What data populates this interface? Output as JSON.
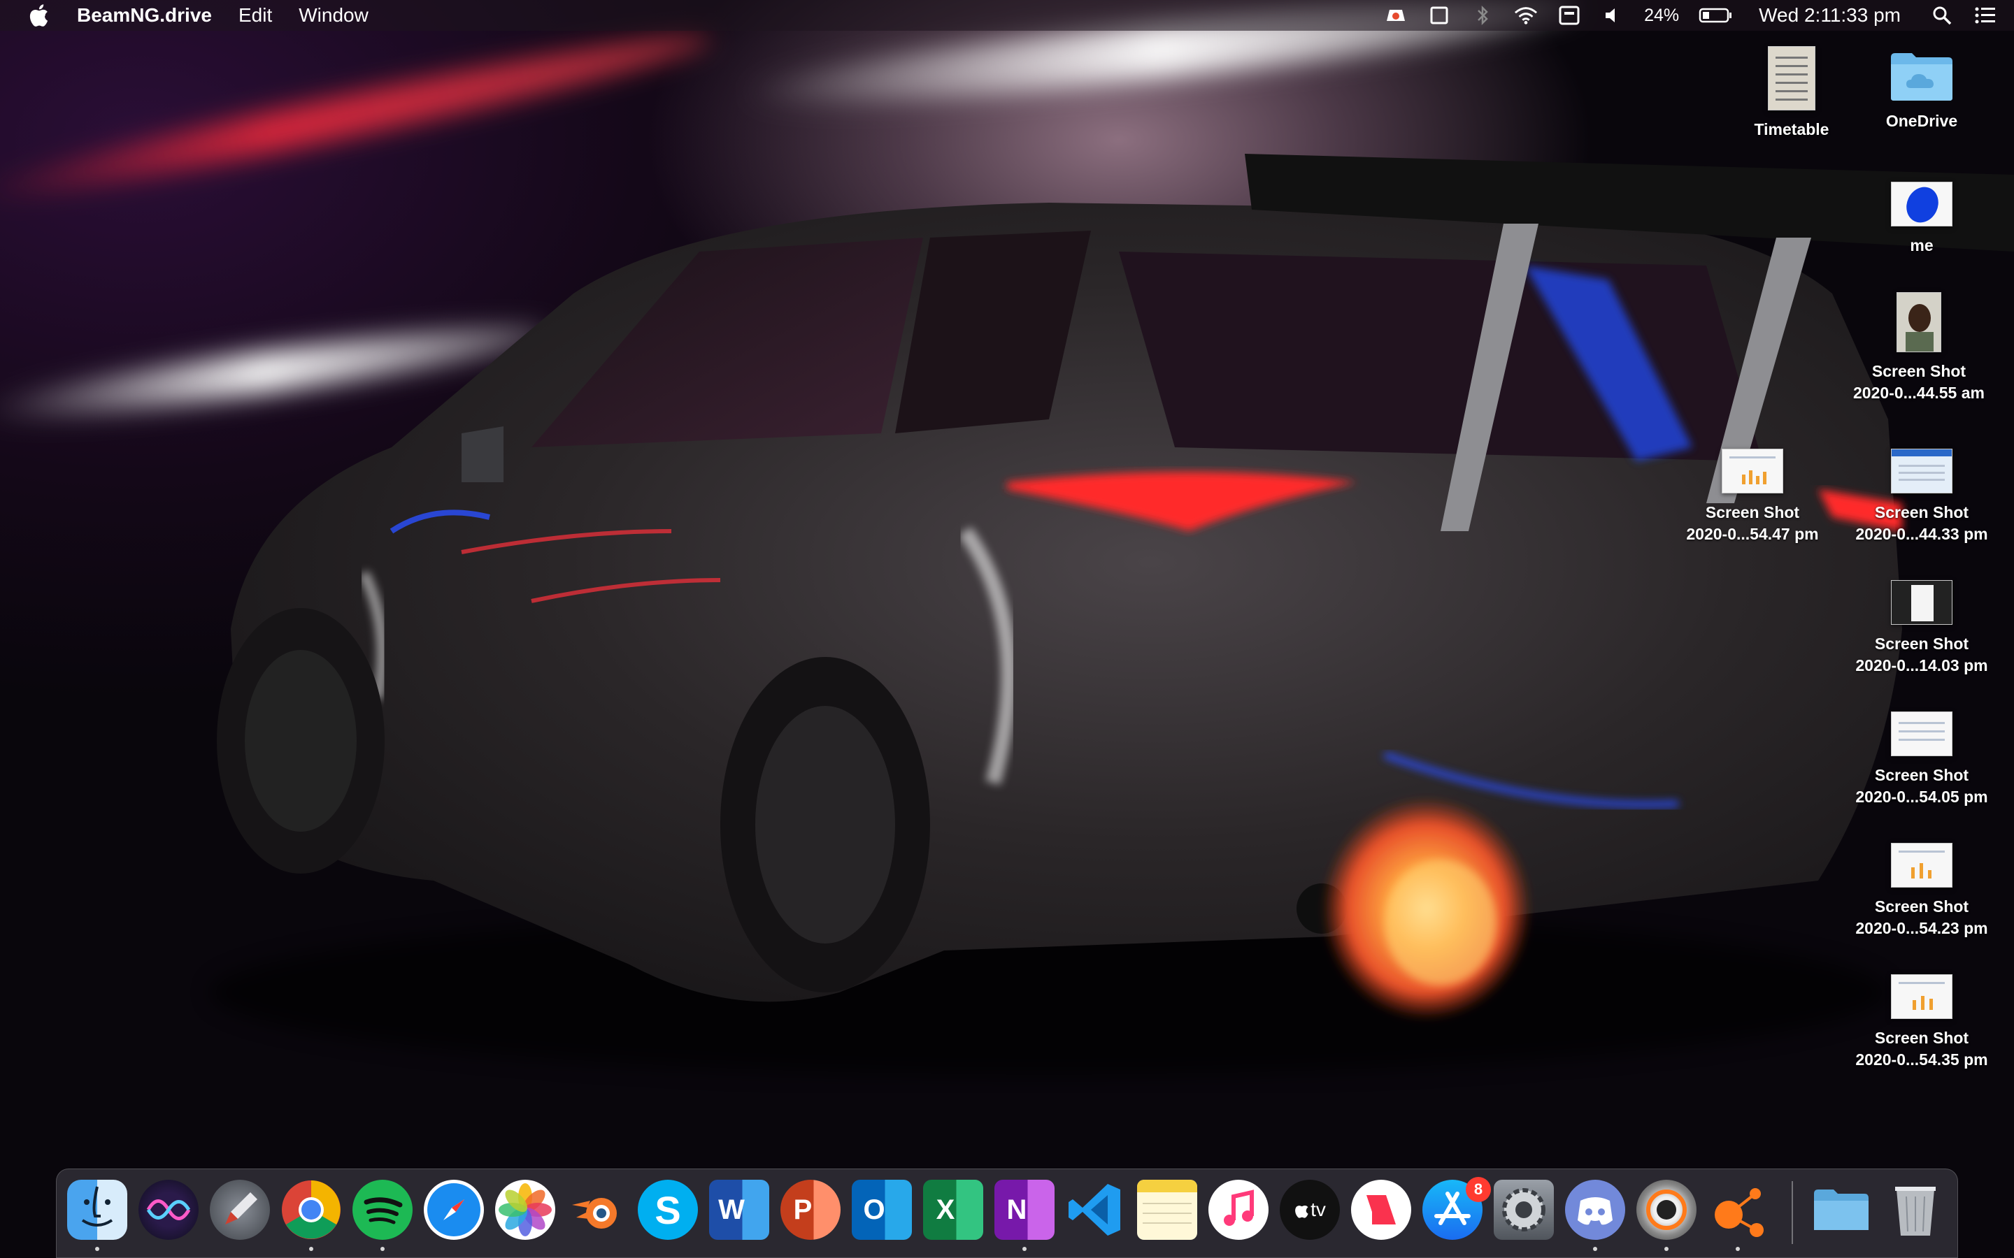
{
  "menubar": {
    "apple_icon": "apple-logo-icon",
    "app_name": "BeamNG.drive",
    "menus": [
      "Edit",
      "Window"
    ],
    "status_icons": [
      "creative-cloud-icon",
      "screen-mirror-icon",
      "bluetooth-icon",
      "wifi-icon",
      "keyboard-input-icon",
      "volume-icon"
    ],
    "battery_percent": "24%",
    "clock": "Wed 2:11:33 pm",
    "search_icon": "spotlight-search-icon",
    "notification_icon": "notification-center-icon"
  },
  "desktop_icons": [
    {
      "label": "Timetable",
      "kind": "document"
    },
    {
      "label": "OneDrive",
      "kind": "folder"
    },
    {
      "label": "me",
      "kind": "image-blue"
    },
    {
      "label": "Screen Shot\n2020-0...44.55 am",
      "kind": "photo"
    },
    {
      "label": "Screen Shot\n2020-0...54.47 pm",
      "kind": "screenshot"
    },
    {
      "label": "Screen Shot\n2020-0...44.33 pm",
      "kind": "screenshot-blue"
    },
    {
      "label": "Screen Shot\n2020-0...14.03 pm",
      "kind": "screenshot-dark"
    },
    {
      "label": "Screen Shot\n2020-0...54.05 pm",
      "kind": "screenshot"
    },
    {
      "label": "Screen Shot\n2020-0...54.23 pm",
      "kind": "screenshot"
    },
    {
      "label": "Screen Shot\n2020-0...54.35 pm",
      "kind": "screenshot"
    }
  ],
  "dock": {
    "apps": [
      {
        "name": "Finder",
        "icon": "finder-icon",
        "running": true
      },
      {
        "name": "Siri",
        "icon": "siri-icon",
        "running": false
      },
      {
        "name": "Launchpad",
        "icon": "launchpad-icon",
        "running": false
      },
      {
        "name": "Google Chrome",
        "icon": "chrome-icon",
        "running": true
      },
      {
        "name": "Spotify",
        "icon": "spotify-icon",
        "running": true
      },
      {
        "name": "Safari",
        "icon": "safari-icon",
        "running": false
      },
      {
        "name": "Photos",
        "icon": "photos-icon",
        "running": false
      },
      {
        "name": "Blender",
        "icon": "blender-icon",
        "running": false
      },
      {
        "name": "Skype",
        "icon": "skype-icon",
        "running": false
      },
      {
        "name": "Microsoft Word",
        "icon": "word-icon",
        "running": false
      },
      {
        "name": "Microsoft PowerPoint",
        "icon": "powerpoint-icon",
        "running": false
      },
      {
        "name": "Microsoft Outlook",
        "icon": "outlook-icon",
        "running": false
      },
      {
        "name": "Microsoft Excel",
        "icon": "excel-icon",
        "running": false
      },
      {
        "name": "Microsoft OneNote",
        "icon": "onenote-icon",
        "running": true
      },
      {
        "name": "Visual Studio Code",
        "icon": "vscode-icon",
        "running": false
      },
      {
        "name": "Notes",
        "icon": "notes-icon",
        "running": false
      },
      {
        "name": "iTunes",
        "icon": "itunes-icon",
        "running": false
      },
      {
        "name": "Apple TV",
        "icon": "apple-tv-icon",
        "running": false
      },
      {
        "name": "News",
        "icon": "news-icon",
        "running": false
      },
      {
        "name": "App Store",
        "icon": "app-store-icon",
        "running": false,
        "badge": "8"
      },
      {
        "name": "System Preferences",
        "icon": "system-preferences-icon",
        "running": false
      },
      {
        "name": "Discord",
        "icon": "discord-icon",
        "running": true
      },
      {
        "name": "BeamNG.drive",
        "icon": "beamng-icon",
        "running": true
      },
      {
        "name": "Orange App",
        "icon": "orange-network-icon",
        "running": true
      }
    ],
    "apple_tv_label": "tv",
    "skype_label": "S",
    "word_label": "W",
    "powerpoint_label": "P",
    "outlook_label": "O",
    "excel_label": "X",
    "onenote_label": "N",
    "stacks": [
      {
        "name": "Downloads Folder",
        "icon": "downloads-folder-icon"
      },
      {
        "name": "Trash",
        "icon": "trash-icon"
      }
    ]
  },
  "colors": {
    "menubar_bg": "#1e141e",
    "accent_red": "#ff3b30",
    "taillight": "#ff2a2a",
    "streak_red": "#e6283c",
    "flame": "#ff8a2a"
  }
}
